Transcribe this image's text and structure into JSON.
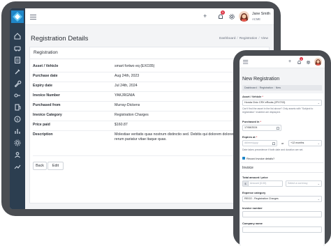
{
  "tablet": {
    "user": {
      "name": "Jane Smith",
      "company": "ACME"
    },
    "notifications_count": "1",
    "page_title": "Registration Details",
    "breadcrumb": [
      "Dashboard",
      "Registration",
      "View"
    ],
    "card_title": "Registration",
    "details": [
      {
        "label": "Asset / Vehicle",
        "value": "smart fortwo eq (EXO35)"
      },
      {
        "label": "Purchase date",
        "value": "Aug 24th, 2023"
      },
      {
        "label": "Expiry date",
        "value": "Jul 24th, 2024"
      },
      {
        "label": "Invoice Number",
        "value": "YAKJRGNIA"
      },
      {
        "label": "Purchased from",
        "value": "Murray-Dickens"
      },
      {
        "label": "Invoice Category",
        "value": "Registration Charges"
      },
      {
        "label": "Price paid",
        "value": "$160.87"
      },
      {
        "label": "Description",
        "value": "Molestiae veritatis quas nostrum distinctio sed. Debitis qui dolorem dolorem eum dolorem rerum pariatur vitae itaque quas."
      }
    ],
    "buttons": {
      "back": "Back",
      "edit": "Edit"
    }
  },
  "phone": {
    "notifications_count": "1",
    "page_title": "New Registration",
    "breadcrumb": [
      "Dashboard",
      "Registration",
      "New"
    ],
    "asset": {
      "label": "Asset / Vehicle",
      "required_mark": "*",
      "value": "Honda Civic CRX eRoots (ZFX7X3)",
      "help": "Can't find the asset in the list above? Only assets with \"Subject to registration\" enabled are displayed."
    },
    "purchased": {
      "label": "Purchased in",
      "required_mark": "*",
      "value": "17/08/2024"
    },
    "expires": {
      "label": "Expires at",
      "required_mark": "*",
      "date_placeholder": "dd/mm/yyyy",
      "or_text": "or",
      "duration_value": "+12 months",
      "help": "Date takes precedence if both date and duration are set."
    },
    "record_invoice_label": "Record invoice details?",
    "invoice_section": "Invoice",
    "amount": {
      "label": "Total amount / price",
      "placeholder": "Amount (0.00)",
      "currency_placeholder": "Select a currency"
    },
    "expense": {
      "label": "Expense category",
      "value": "REGO - Registration Charges"
    },
    "invoice_number_label": "Invoice number",
    "company_label": "Company name"
  }
}
